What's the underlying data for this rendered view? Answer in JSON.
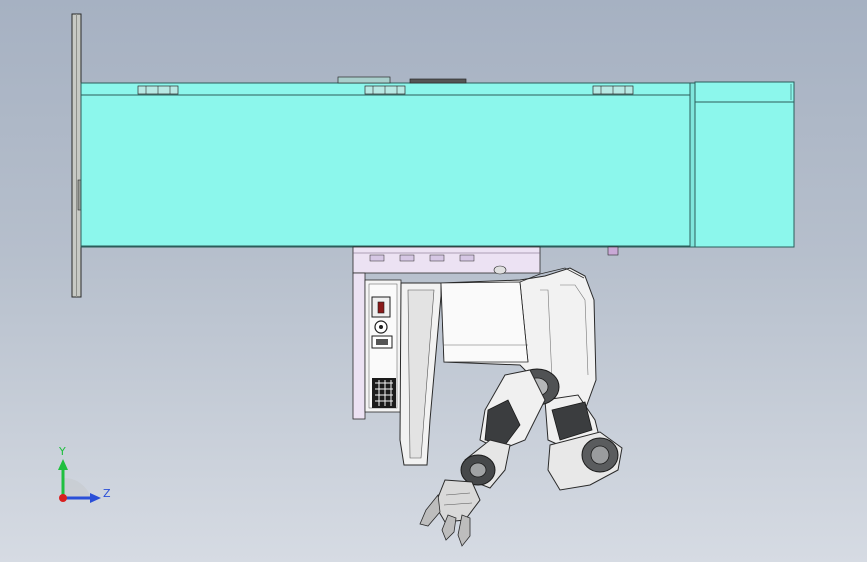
{
  "triad": {
    "y_label": "Y",
    "z_label": "Z",
    "colors": {
      "y": "#1fbf3f",
      "z": "#2a4fd8",
      "x": "#d81f1f"
    }
  },
  "colors": {
    "background_top": "#a6b1c2",
    "background_bottom": "#d6dbe3",
    "rail": "#c7c9c4",
    "beam": "#8cf7ec",
    "beam_edge": "#2b5c5a",
    "carriage": "#ece2f3",
    "arm_white": "#f2f2f2",
    "arm_dark": "#3b3d3f",
    "line": "#2a2a2a"
  },
  "icons": [
    "coordinate-triad-icon",
    "toggle-switch-icon",
    "power-socket-icon",
    "vent-grille-icon"
  ]
}
